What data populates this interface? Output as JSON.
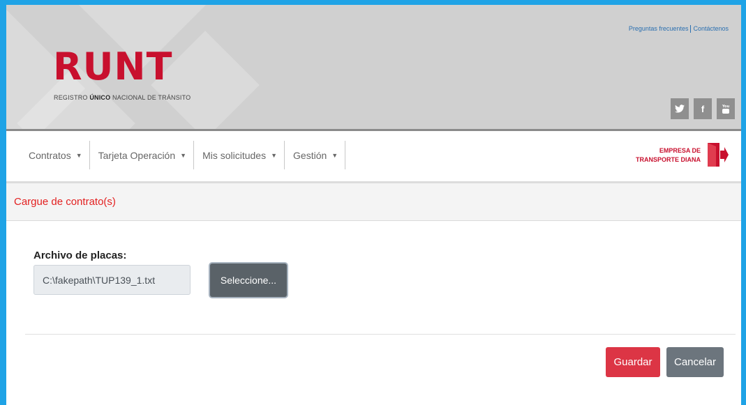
{
  "header": {
    "logo_text": "RUNT",
    "logo_subtitle_pre": "REGISTRO ",
    "logo_subtitle_bold": "ÚNICO",
    "logo_subtitle_post": " NACIONAL DE TRÁNSITO",
    "links": [
      "Preguntas frecuentes",
      "Contáctenos"
    ],
    "social": [
      {
        "icon": "twitter-icon",
        "glyph": "🐦"
      },
      {
        "icon": "facebook-icon",
        "glyph": "f"
      },
      {
        "icon": "youtube-icon",
        "glyph": "▶"
      }
    ]
  },
  "nav": {
    "items": [
      {
        "label": "Contratos"
      },
      {
        "label": "Tarjeta Operación"
      },
      {
        "label": "Mis solicitudes"
      },
      {
        "label": "Gestión"
      }
    ],
    "company_line1": "EMPRESA DE",
    "company_line2": "TRANSPORTE DIANA"
  },
  "section": {
    "title": "Cargue de contrato(s)"
  },
  "form": {
    "file_label": "Archivo de placas:",
    "file_value": "C:\\fakepath\\TUP139_1.txt",
    "select_button": "Seleccione..."
  },
  "actions": {
    "save": "Guardar",
    "cancel": "Cancelar"
  },
  "colors": {
    "brand_red": "#c8102e",
    "frame_blue": "#1fa3e6",
    "save_red": "#dc3545",
    "cancel_gray": "#6c757d"
  }
}
